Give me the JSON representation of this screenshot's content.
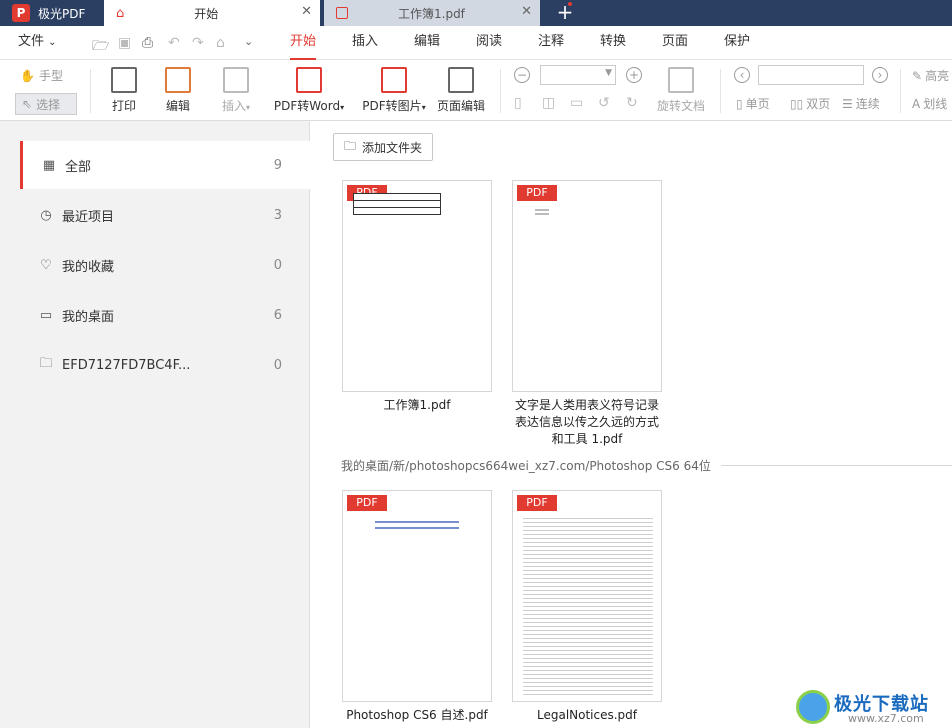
{
  "titlebar": {
    "app_name": "极光PDF",
    "logo_letter": "P",
    "tabs": [
      {
        "label": "开始",
        "active": true
      },
      {
        "label": "工作簿1.pdf",
        "active": false
      }
    ]
  },
  "menu": {
    "file_label": "文件",
    "items": [
      "开始",
      "插入",
      "编辑",
      "阅读",
      "注释",
      "转换",
      "页面",
      "保护"
    ]
  },
  "toolbar": {
    "hand_label": "手型",
    "select_label": "选择",
    "print_label": "打印",
    "edit_label": "编辑",
    "insert_label": "插入",
    "pdf_to_word_label": "PDF转Word",
    "pdf_to_image_label": "PDF转图片",
    "page_edit_label": "页面编辑",
    "rotate_label": "旋转文档",
    "single_page_label": "单页",
    "double_page_label": "双页",
    "continuous_label": "连续",
    "highlight_label": "高亮",
    "strikethrough_label": "划线"
  },
  "sidebar": {
    "items": [
      {
        "label": "全部",
        "count": "9",
        "icon": "grid-icon"
      },
      {
        "label": "最近项目",
        "count": "3",
        "icon": "clock-icon"
      },
      {
        "label": "我的收藏",
        "count": "0",
        "icon": "heart-icon"
      },
      {
        "label": "我的桌面",
        "count": "6",
        "icon": "monitor-icon"
      },
      {
        "label": "EFD7127FD7BC4F...",
        "count": "0",
        "icon": "folder-icon"
      }
    ]
  },
  "main": {
    "add_folder_label": "添加文件夹",
    "badge": "PDF",
    "files_top": [
      {
        "title": "工作簿1.pdf"
      },
      {
        "title_lines": [
          "文字是人类用表义符号记录",
          "表达信息以传之久远的方式",
          "和工具 1.pdf"
        ]
      }
    ],
    "path": "我的桌面/新/photoshopcs664wei_xz7.com/Photoshop CS6 64位",
    "files_bottom": [
      {
        "title": "Photoshop CS6 自述.pdf"
      },
      {
        "title": "LegalNotices.pdf"
      }
    ]
  },
  "watermark": {
    "text": "极光下载站",
    "url": "www.xz7.com"
  },
  "colors": {
    "accent": "#e03a31",
    "titlebar": "#2b3f63",
    "sidebar": "#f2f2f2"
  }
}
